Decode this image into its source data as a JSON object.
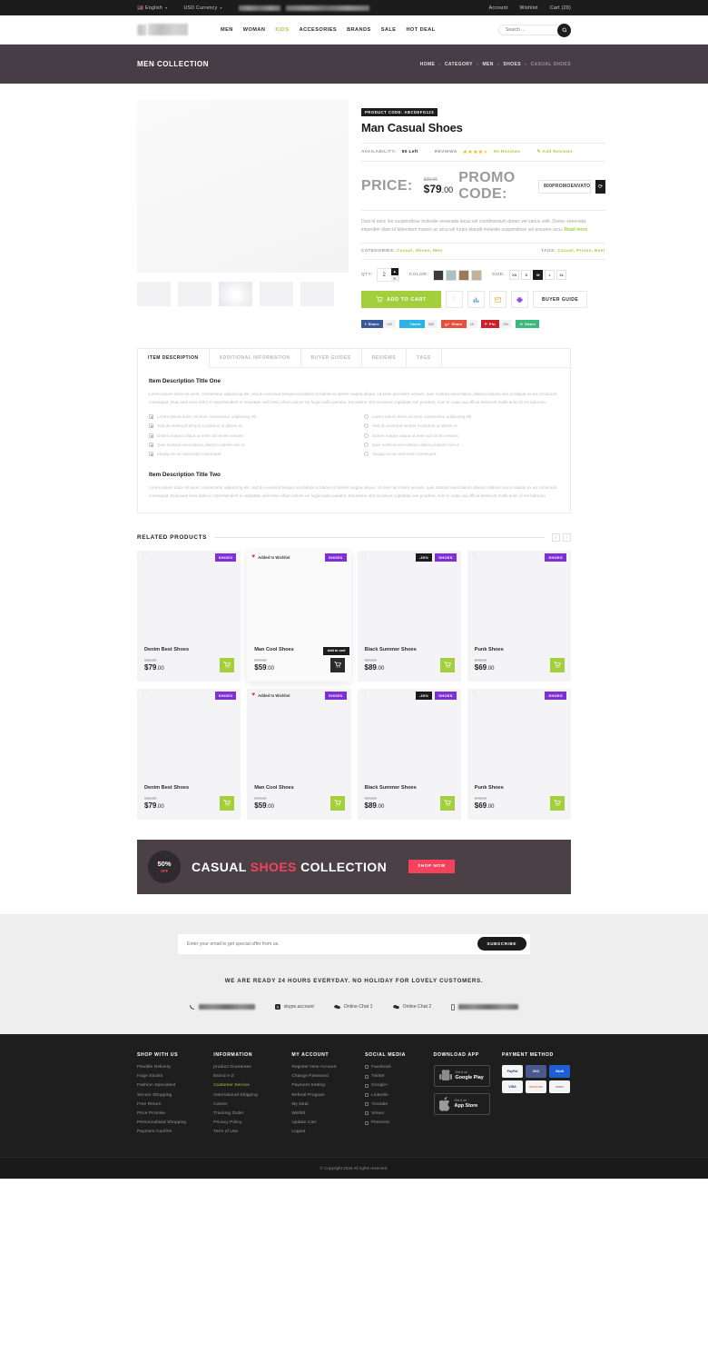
{
  "topbar": {
    "language": "English",
    "currency": "USD Currency",
    "account": "Account",
    "wishlist": "Wishlist",
    "cart_label": "Cart",
    "cart_count": "(20)"
  },
  "nav": {
    "links": [
      {
        "label": "MEN",
        "active": false
      },
      {
        "label": "WOMAN",
        "active": false
      },
      {
        "label": "KIDS",
        "active": true
      },
      {
        "label": "ACCESORIES",
        "active": false
      },
      {
        "label": "BRANDS",
        "active": false
      },
      {
        "label": "SALE",
        "active": false
      },
      {
        "label": "HOT DEAL",
        "active": false
      }
    ],
    "search_placeholder": "Search ..."
  },
  "pagehead": {
    "title": "MEN COLLECTION",
    "breadcrumb": [
      "HOME",
      "CATEGORY",
      "MEN",
      "SHOES"
    ],
    "current": "CASUAL SHOES"
  },
  "product": {
    "code_label": "PRODUCT CODE:",
    "code": "ABCDEFG123",
    "title": "Man Casual Shoes",
    "availability_label": "AVAILABILITY:",
    "availability": "90 Left",
    "reviews_label": "REVIEWS",
    "stars": "★★★★",
    "half_star": "★",
    "reviews_count": "90 Reviews",
    "add_reviews": "Add Reviews",
    "price_label": "PRICE:",
    "price_old": "$89.00",
    "price_new_main": "$79",
    "price_new_cents": ".00",
    "promo_label": "PROMO CODE:",
    "promo_value": "800PROMOENVATO",
    "description": "Duis id nunc leo suspendisse molestie venenatis lacus vel condimentum donec vel varius velit. Donec venenatis imperdiet diam id bibendum mauris ac arcu vel turpis blandit molestie suspendisse vel posuere arcu.",
    "read_more": "Read more",
    "categories_label": "CATEGORIES:",
    "categories": "Casual, Shoes, Men",
    "tags_label": "TAGS:",
    "tags": "Casual, Promo, Best",
    "qty_label": "QTY:",
    "qty_value": "2",
    "color_label": "COLOR:",
    "colors": [
      "#3a3a3a",
      "#a9bfc2",
      "#9c7a55",
      "#c2b49a"
    ],
    "size_label": "SIZE:",
    "sizes": [
      "XS",
      "S",
      "M",
      "L",
      "XL"
    ],
    "selected_size": "M",
    "add_to_cart": "ADD TO CART",
    "buyer_guide": "BUYER GUIDE",
    "icon_buttons": [
      "heart-icon",
      "compare-icon",
      "email-icon",
      "print-icon"
    ]
  },
  "share": [
    {
      "network": "facebook",
      "label": "Share",
      "count": "150",
      "color": "#3b5998"
    },
    {
      "network": "twitter",
      "label": "Tweet",
      "count": "856",
      "color": "#2ab3e8"
    },
    {
      "network": "google-plus",
      "label": "Share",
      "count": "25",
      "color": "#e4503b"
    },
    {
      "network": "pinterest",
      "label": "Pin",
      "count": "15k",
      "color": "#cb2027"
    },
    {
      "network": "share",
      "label": "Share",
      "count": "",
      "color": "#3cb878"
    }
  ],
  "tabs": {
    "items": [
      "ITEM DESCRIPTION",
      "ADDITIONAL INFORMATION",
      "BUYER GUIDES",
      "REVIEWS",
      "TAGS"
    ],
    "active": "ITEM DESCRIPTION",
    "heading_one": "Item Description Title One",
    "paragraph_one": "Lorem ipsum dolor sit amet, consectetur adipiscing elit, sed do eiusmod tempor incididunt ut labore et dolore magna aliqua. Ut enim ad minim veniam, quis nostrud exercitation ullamco laboris nisi ut aliquip ex ea commodo consequat. Duis aute irure dolor in reprehenderit in voluptate velit esse cillum dolore eu fugiat nulla pariatur. Excepteur sint occaecat cupidatat non proident, sunt in culpa qui officia deserunt mollit anim id est laborum.",
    "list_left": [
      "Lorem ipsum dolor sit amet consectetur adipiscing elit.",
      "Sed do eiusmod tempor incididunt ut labore et.",
      "Dolore magna aliqua ut enim ad minim veniam.",
      "Quis nostrud exercitation ullamco laboris nisi ut .",
      "Aliquip ex ea commodo consequat."
    ],
    "list_right": [
      "Lorem ipsum dolor sit amet consectetur adipiscing elit.",
      "Sed do eiusmod tempor incididunt ut labore et.",
      "Dolore magna aliqua ut enim ad minim veniam.",
      "Quis nostrud exercitation ullamco laboris nisi ut .",
      "Aliquip ex ea commodo consequat."
    ],
    "heading_two": "Item Description Title Two",
    "paragraph_two": "Lorem ipsum dolor sit amet, consectetur adipiscing elit, sed do eiusmod tempor incididunt ut labore et dolore magna aliqua. Ut enim ad minim veniam, quis nostrud exercitation ullamco laboris nisi ut aliquip ex ea commodo consequat. Duis aute irure dolor in reprehenderit in voluptate velit esse cillum dolore eu fugiat nulla pariatur. Excepteur sint occaecat cupidatat non proident, sunt in culpa qui officia deserunt mollit anim id est laborum."
  },
  "related": {
    "title": "RELATED PRODUCTS",
    "prev": "‹",
    "next": "›",
    "row1": [
      {
        "name": "Denim Best Shoes",
        "old": "$89.00",
        "price_main": "$79",
        "price_cents": ".00",
        "badge": "SHOES",
        "discount": "",
        "wishlisted": false,
        "wishlist_text": "",
        "highlight": false,
        "tooltip": ""
      },
      {
        "name": "Man Cool Shoes",
        "old": "$79.00",
        "price_main": "$59",
        "price_cents": ".00",
        "badge": "SHOES",
        "discount": "",
        "wishlisted": true,
        "wishlist_text": "Added to Wishlist",
        "highlight": true,
        "tooltip": "Add to cart"
      },
      {
        "name": "Black Summer Shoes",
        "old": "$99.00",
        "price_main": "$89",
        "price_cents": ".00",
        "badge": "SHOES",
        "discount": "-30%",
        "wishlisted": false,
        "wishlist_text": "",
        "highlight": false,
        "tooltip": ""
      },
      {
        "name": "Punk Shoes",
        "old": "$79.00",
        "price_main": "$69",
        "price_cents": ".00",
        "badge": "SHOES",
        "discount": "",
        "wishlisted": false,
        "wishlist_text": "",
        "highlight": false,
        "tooltip": ""
      }
    ],
    "row2": [
      {
        "name": "Denim Best Shoes",
        "old": "$89.00",
        "price_main": "$79",
        "price_cents": ".00",
        "badge": "SHOES",
        "discount": "",
        "wishlisted": false,
        "wishlist_text": "",
        "highlight": false,
        "tooltip": ""
      },
      {
        "name": "Man Cool Shoes",
        "old": "$79.00",
        "price_main": "$59",
        "price_cents": ".00",
        "badge": "SHOES",
        "discount": "",
        "wishlisted": true,
        "wishlist_text": "Added to Wishlist",
        "highlight": false,
        "tooltip": ""
      },
      {
        "name": "Black Summer Shoes",
        "old": "$99.00",
        "price_main": "$89",
        "price_cents": ".00",
        "badge": "SHOES",
        "discount": "-30%",
        "wishlisted": false,
        "wishlist_text": "",
        "highlight": false,
        "tooltip": ""
      },
      {
        "name": "Punk Shoes",
        "old": "$79.00",
        "price_main": "$69",
        "price_cents": ".00",
        "badge": "SHOES",
        "discount": "",
        "wishlisted": false,
        "wishlist_text": "",
        "highlight": false,
        "tooltip": ""
      }
    ]
  },
  "banner": {
    "percent": "50%",
    "off": "OFF",
    "text_1": "CASUAL",
    "text_hi": "SHOES",
    "text_2": "COLLECTION",
    "cta": "SHOP NOW"
  },
  "newsletter": {
    "placeholder": "Enter your email to get special offer from us.",
    "button": "SUBSCRIBE",
    "ready_text": "WE ARE READY 24 HOURS EVERYDAY. NO HOLIDAY FOR LOVELY CUSTOMERS.",
    "contacts": [
      {
        "icon": "phone-icon",
        "label": "",
        "blurred": true
      },
      {
        "icon": "skype-icon",
        "label": "skype.account",
        "blurred": false
      },
      {
        "icon": "chat-icon",
        "label": "Online Chat 1",
        "blurred": false
      },
      {
        "icon": "chat-icon",
        "label": "Online Chat 2",
        "blurred": false
      },
      {
        "icon": "mobile-icon",
        "label": "",
        "blurred": true
      }
    ]
  },
  "footer": {
    "columns": [
      {
        "title": "SHOP WITH US",
        "links": [
          {
            "label": "Flexible Delivery",
            "highlight": false
          },
          {
            "label": "Huge Stocks",
            "highlight": false
          },
          {
            "label": "Fashion Specialest",
            "highlight": false
          },
          {
            "label": "Secure Shopping",
            "highlight": false
          },
          {
            "label": "Free Return",
            "highlight": false
          },
          {
            "label": "Price Promise",
            "highlight": false
          },
          {
            "label": "Personnalised Shopping",
            "highlight": false
          },
          {
            "label": "Payment Confirm",
            "highlight": false
          }
        ]
      },
      {
        "title": "INFORMATION",
        "links": [
          {
            "label": "product Guarantee",
            "highlight": false
          },
          {
            "label": "Brand A-Z",
            "highlight": false
          },
          {
            "label": "Customer Service",
            "highlight": true
          },
          {
            "label": "International Shipping",
            "highlight": false
          },
          {
            "label": "Career",
            "highlight": false
          },
          {
            "label": "Tracking Order",
            "highlight": false
          },
          {
            "label": "Privacy Policy",
            "highlight": false
          },
          {
            "label": "Term of Use",
            "highlight": false
          }
        ]
      },
      {
        "title": "MY ACCOUNT",
        "links": [
          {
            "label": "Register New Account",
            "highlight": false
          },
          {
            "label": "Change Password",
            "highlight": false
          },
          {
            "label": "Payment Setting",
            "highlight": false
          },
          {
            "label": "Referal Program",
            "highlight": false
          },
          {
            "label": "My Deal",
            "highlight": false
          },
          {
            "label": "Wishlit",
            "highlight": false
          },
          {
            "label": "Update Cart",
            "highlight": false
          },
          {
            "label": "Logout",
            "highlight": false
          }
        ]
      }
    ],
    "social": {
      "title": "SOCIAL MEDIA",
      "links": [
        "Facebook",
        "Twitter",
        "Google+",
        "Linkedin",
        "Youtube",
        "Vimeo",
        "Pinterest"
      ]
    },
    "download": {
      "title": "DOWNLOAD APP",
      "buttons": [
        {
          "icon": "android-icon",
          "small": "Get it on",
          "big": "Google Play"
        },
        {
          "icon": "apple-icon",
          "small": "Get it on",
          "big": "App Store"
        }
      ]
    },
    "payment": {
      "title": "PAYMENT METHOD",
      "methods": [
        {
          "name": "PayPal",
          "bg": "#f3f4f6",
          "fg": "#243a80"
        },
        {
          "name": "2CO",
          "bg": "#4a5a8c",
          "fg": "#ffffff"
        },
        {
          "name": "Skrill",
          "bg": "#1e5fd6",
          "fg": "#ffffff"
        },
        {
          "name": "VISA",
          "bg": "#f3f4f6",
          "fg": "#1a3a8f"
        },
        {
          "name": "DISCOVER",
          "bg": "#f3f4f6",
          "fg": "#e07b20"
        },
        {
          "name": "AMEX",
          "bg": "#f3f4f6",
          "fg": "#7a7a7a"
        }
      ]
    },
    "copyright": "© Copyright 2015 All rights reserved."
  }
}
